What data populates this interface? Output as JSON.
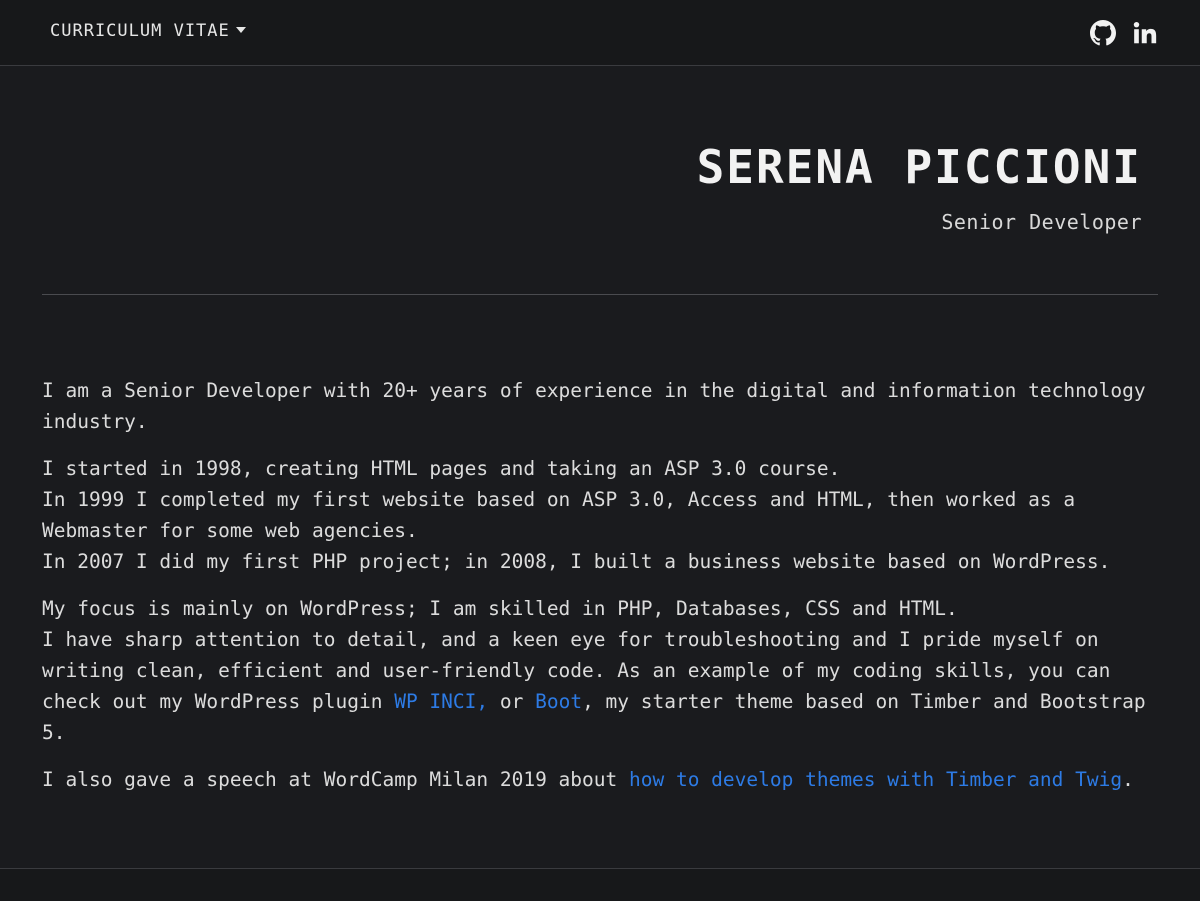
{
  "nav": {
    "menu_label": "CURRICULUM VITAE",
    "social": [
      {
        "icon": "github-icon"
      },
      {
        "icon": "linkedin-icon"
      }
    ]
  },
  "header": {
    "name": "SERENA PICCIONI",
    "title": "Senior Developer"
  },
  "bio": {
    "p1": "I am a Senior Developer with 20+ years of experience in the digital and information technology industry.",
    "p2_l1": "I started in 1998, creating HTML pages and taking an ASP 3.0 course.",
    "p2_l2": "In 1999 I completed my first website based on ASP 3.0, Access and HTML, then worked as a Webmaster for some web agencies.",
    "p2_l3": "In 2007 I did my first PHP project; in 2008, I built a business website based on WordPress.",
    "p3_l1": "My focus is mainly on WordPress; I am skilled in PHP, Databases, CSS and HTML.",
    "p3_l2_a": "I have sharp attention to detail, and a keen eye for troubleshooting and I pride myself on writing clean, efficient and user-friendly code. As an example of my coding skills, you can check out my WordPress plugin ",
    "p3_link1": "WP INCI,",
    "p3_l2_b": " or ",
    "p3_link2": "Boot",
    "p3_l2_c": ", my starter theme based on Timber and Bootstrap 5.",
    "p4_a": "I also gave a speech at WordCamp Milan 2019 about ",
    "p4_link": "how to develop themes with Timber and Twig",
    "p4_b": "."
  },
  "colors": {
    "background": "#1a1b1e",
    "link": "#2d7be5",
    "text": "#dcdcdc"
  }
}
